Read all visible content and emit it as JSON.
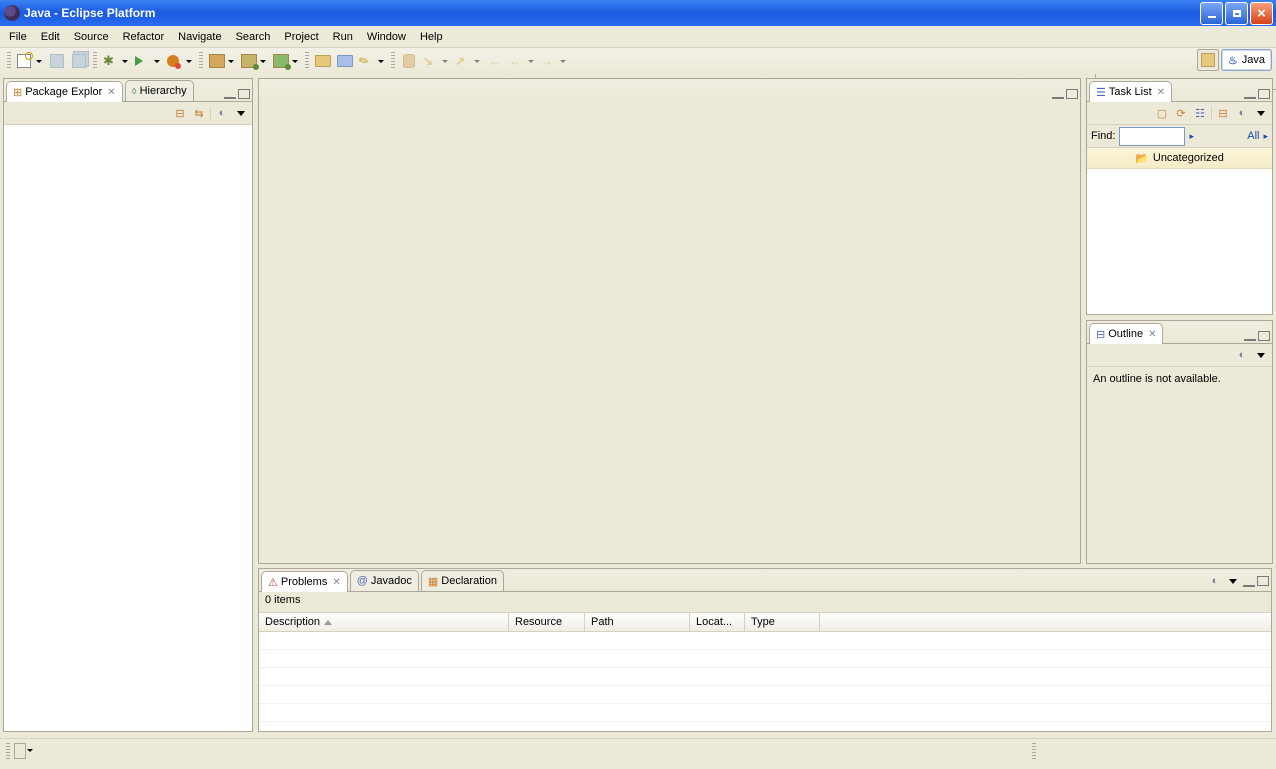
{
  "title": "Java - Eclipse Platform",
  "menu": [
    "File",
    "Edit",
    "Source",
    "Refactor",
    "Navigate",
    "Search",
    "Project",
    "Run",
    "Window",
    "Help"
  ],
  "perspective": {
    "current": "Java"
  },
  "left": {
    "tabs": [
      {
        "label": "Package Explor",
        "active": true
      },
      {
        "label": "Hierarchy",
        "active": false
      }
    ]
  },
  "tasklist": {
    "title": "Task List",
    "find_label": "Find:",
    "all_label": "All",
    "category": "Uncategorized"
  },
  "outline": {
    "title": "Outline",
    "message": "An outline is not available."
  },
  "bottom": {
    "tabs": [
      {
        "label": "Problems",
        "active": true
      },
      {
        "label": "Javadoc",
        "active": false
      },
      {
        "label": "Declaration",
        "active": false
      }
    ],
    "items_label": "0 items",
    "columns": [
      "Description",
      "Resource",
      "Path",
      "Locat...",
      "Type"
    ]
  }
}
